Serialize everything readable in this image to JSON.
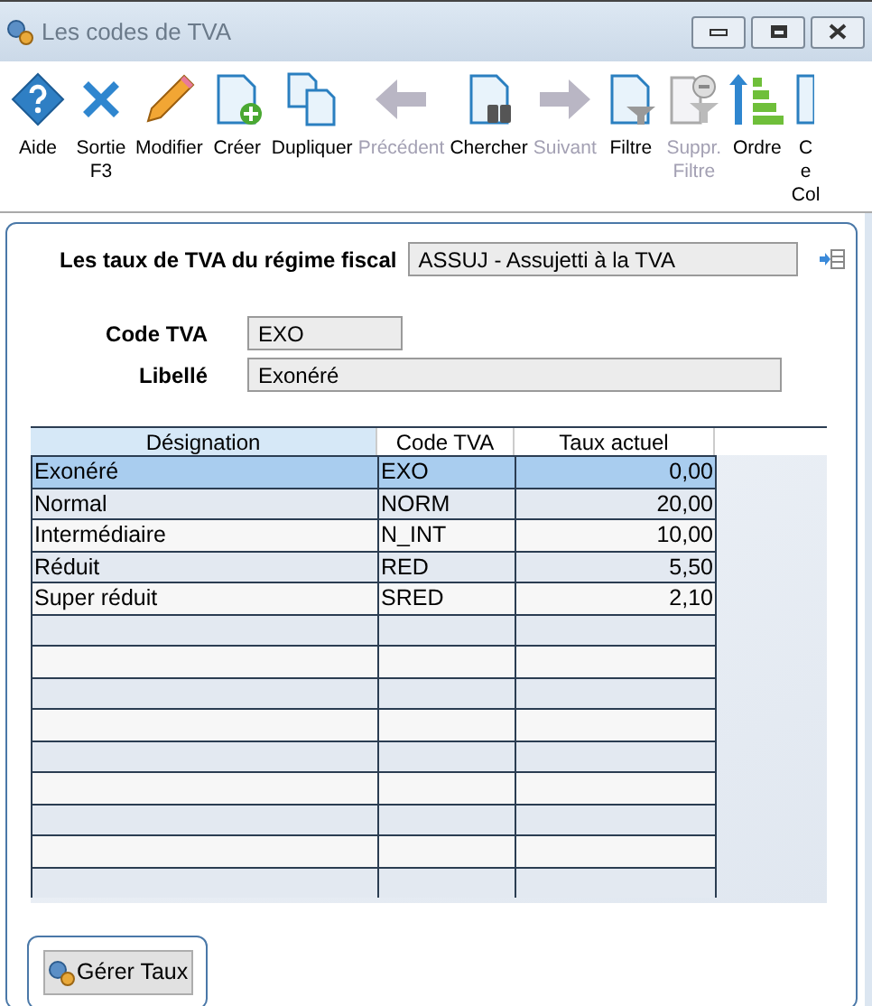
{
  "window": {
    "title": "Les codes de TVA"
  },
  "toolbar": [
    {
      "kind": "help",
      "lines": [
        "Aide"
      ],
      "disabled": false
    },
    {
      "kind": "exit",
      "lines": [
        "Sortie",
        "F3"
      ],
      "disabled": false
    },
    {
      "kind": "edit",
      "lines": [
        "Modifier"
      ],
      "disabled": false
    },
    {
      "kind": "create",
      "lines": [
        "Créer"
      ],
      "disabled": false
    },
    {
      "kind": "duplicate",
      "lines": [
        "Dupliquer"
      ],
      "disabled": false
    },
    {
      "kind": "prev",
      "lines": [
        "Précédent"
      ],
      "disabled": true
    },
    {
      "kind": "search",
      "lines": [
        "Chercher"
      ],
      "disabled": false
    },
    {
      "kind": "next",
      "lines": [
        "Suivant"
      ],
      "disabled": true
    },
    {
      "kind": "filter",
      "lines": [
        "Filtre"
      ],
      "disabled": false
    },
    {
      "kind": "unfilter",
      "lines": [
        "Suppr.",
        "Filtre"
      ],
      "disabled": true
    },
    {
      "kind": "order",
      "lines": [
        "Ordre"
      ],
      "disabled": false
    },
    {
      "kind": "columns",
      "lines": [
        "C",
        "e",
        "Col"
      ],
      "disabled": false
    }
  ],
  "regime": {
    "label": "Les taux de TVA du régime fiscal",
    "value": "ASSUJ - Assujetti à la TVA"
  },
  "fields": [
    {
      "label": "Code TVA",
      "value": "EXO",
      "wide": false
    },
    {
      "label": "Libellé",
      "value": "Exonéré",
      "wide": true
    }
  ],
  "table": {
    "columns": [
      "Désignation",
      "Code TVA",
      "Taux actuel"
    ],
    "rows": [
      {
        "cells": [
          "Exonéré",
          "EXO",
          "0,00"
        ],
        "selected": true
      },
      {
        "cells": [
          "Normal",
          "NORM",
          "20,00"
        ],
        "selected": false
      },
      {
        "cells": [
          "Intermédiaire",
          "N_INT",
          "10,00"
        ],
        "selected": false
      },
      {
        "cells": [
          "Réduit",
          "RED",
          "5,50"
        ],
        "selected": false
      },
      {
        "cells": [
          "Super réduit",
          "SRED",
          "2,10"
        ],
        "selected": false
      }
    ]
  },
  "button": {
    "label": "Gérer Taux"
  }
}
